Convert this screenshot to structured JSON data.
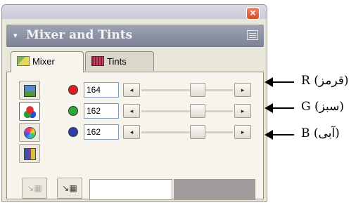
{
  "window": {
    "close_label": "×"
  },
  "header": {
    "collapse_glyph": "▾",
    "title": "Mixer and Tints"
  },
  "tabs": [
    {
      "label": "Mixer",
      "icon": "mixer-icon",
      "active": true
    },
    {
      "label": "Tints",
      "icon": "tints-icon",
      "active": false
    }
  ],
  "mode_buttons": [
    {
      "name": "picture-mode",
      "icon": "picture-icon",
      "active": false
    },
    {
      "name": "rgb-mode",
      "icon": "rgb-circles-icon",
      "active": true
    },
    {
      "name": "color-wheel-mode",
      "icon": "color-wheel-icon",
      "active": false
    },
    {
      "name": "swatch-mode",
      "icon": "swatch-grid-icon",
      "active": false
    }
  ],
  "channels": [
    {
      "name": "red",
      "value": "164",
      "dot_color": "#e02020",
      "level": 0.64
    },
    {
      "name": "green",
      "value": "162",
      "dot_color": "#2fa83a",
      "level": 0.64
    },
    {
      "name": "blue",
      "value": "162",
      "dot_color": "#2f3fa8",
      "level": 0.64
    }
  ],
  "slider_arrows": {
    "left": "◂",
    "right": "▸"
  },
  "bottom_buttons": {
    "add_to_swatches_label": "↘▦",
    "add_to_swatches_disabled_label": "↘▦"
  },
  "swatches": {
    "new_color": "#ffffff",
    "old_color": "#a09c9c"
  },
  "annotations": [
    {
      "label": "R (قرمز)"
    },
    {
      "label": "G (سبز)"
    },
    {
      "label": "B (آبی)"
    }
  ]
}
